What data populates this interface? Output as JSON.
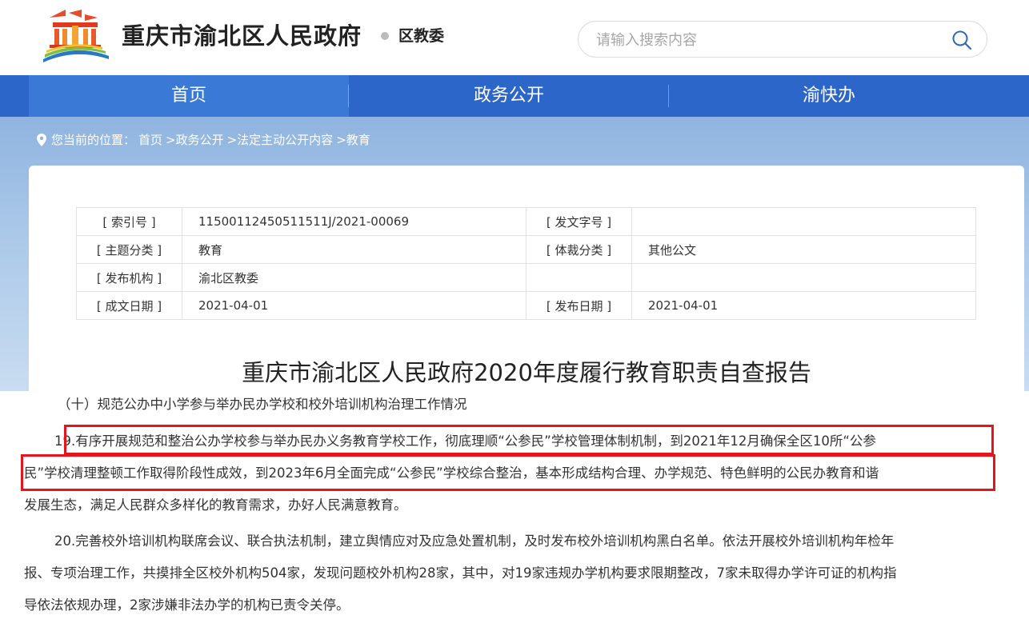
{
  "header": {
    "site_title": "重庆市渝北区人民政府",
    "sub_title": "区教委",
    "logo_icon": "government-building-logo"
  },
  "search": {
    "placeholder": "请输入搜索内容",
    "icon": "search-icon"
  },
  "nav": {
    "items": [
      {
        "label": "首页"
      },
      {
        "label": "政务公开"
      },
      {
        "label": "渝快办"
      }
    ],
    "active_index": 0
  },
  "breadcrumb": {
    "prefix": "您当前的位置：",
    "items": [
      "首页",
      ">政务公开",
      ">法定主动公开内容",
      ">教育"
    ]
  },
  "meta": {
    "rows": [
      {
        "k1": "[ 索引号 ]",
        "v1": "11500112450511511J/2021-00069",
        "k2": "[ 发文字号 ]",
        "v2": ""
      },
      {
        "k1": "[ 主题分类 ]",
        "v1": "教育",
        "k2": "[ 体裁分类 ]",
        "v2": "其他公文"
      },
      {
        "k1": "[ 发布机构 ]",
        "v1": "渝北区教委",
        "k2": "",
        "v2": ""
      },
      {
        "k1": "[ 成文日期 ]",
        "v1": "2021-04-01",
        "k2": "[ 发布日期 ]",
        "v2": "2021-04-01"
      }
    ]
  },
  "document": {
    "title": "重庆市渝北区人民政府2020年度履行教育职责自查报告",
    "section": "（十）规范公办中小学参与举办民办学校和校外培训机构治理工作情况",
    "para19": {
      "line1": "19.有序开展规范和整治公办学校参与举办民办义务教育学校工作，彻底理顺“公参民”学校管理体制机制，到2021年12月确保全区10所“公参",
      "line2": "民”学校清理整顿工作取得阶段性成效，到2023年6月全面完成“公参民”学校综合整治，基本形成结构合理、办学规范、特色鲜明的公民办教育和谐",
      "line3": "发展生态，满足人民群众多样化的教育需求，办好人民满意教育。"
    },
    "para20": {
      "line1": "20.完善校外培训机构联席会议、联合执法机制，建立舆情应对及应急处置机制，及时发布校外培训机构黑白名单。依法开展校外培训机构年检年",
      "line2": "报、专项治理工作，共摸排全区校外机构504家，发现问题校外机构28家，其中，对19家违规办学机构要求限期整改，7家未取得办学许可证的机构指",
      "line3": "导依法依规办理，2家涉嫌非法办学的机构已责令关停。"
    }
  },
  "colors": {
    "nav_bg": "#2d66c9",
    "nav_active": "#3a7ad6",
    "highlight_box": "#e8141b"
  }
}
